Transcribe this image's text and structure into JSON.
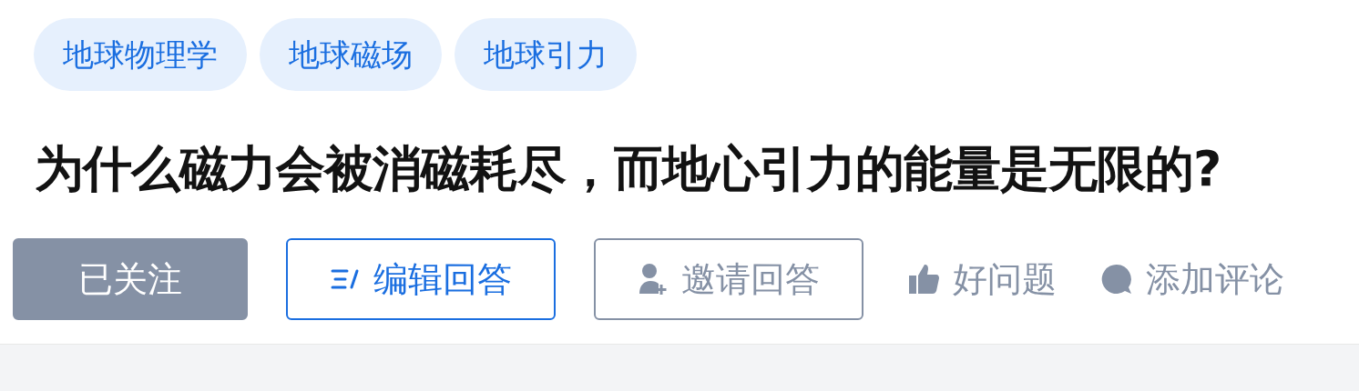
{
  "topics": [
    "地球物理学",
    "地球磁场",
    "地球引力"
  ],
  "title": "为什么磁力会被消磁耗尽，而地心引力的能量是无限的?",
  "actions": [
    {
      "kind": "follow",
      "label": "已关注",
      "followed": true
    },
    {
      "kind": "edit",
      "label": "编辑回答"
    },
    {
      "kind": "invite",
      "label": "邀请回答"
    },
    {
      "kind": "like",
      "label": "好问题"
    },
    {
      "kind": "comment",
      "label": "添加评论"
    }
  ]
}
